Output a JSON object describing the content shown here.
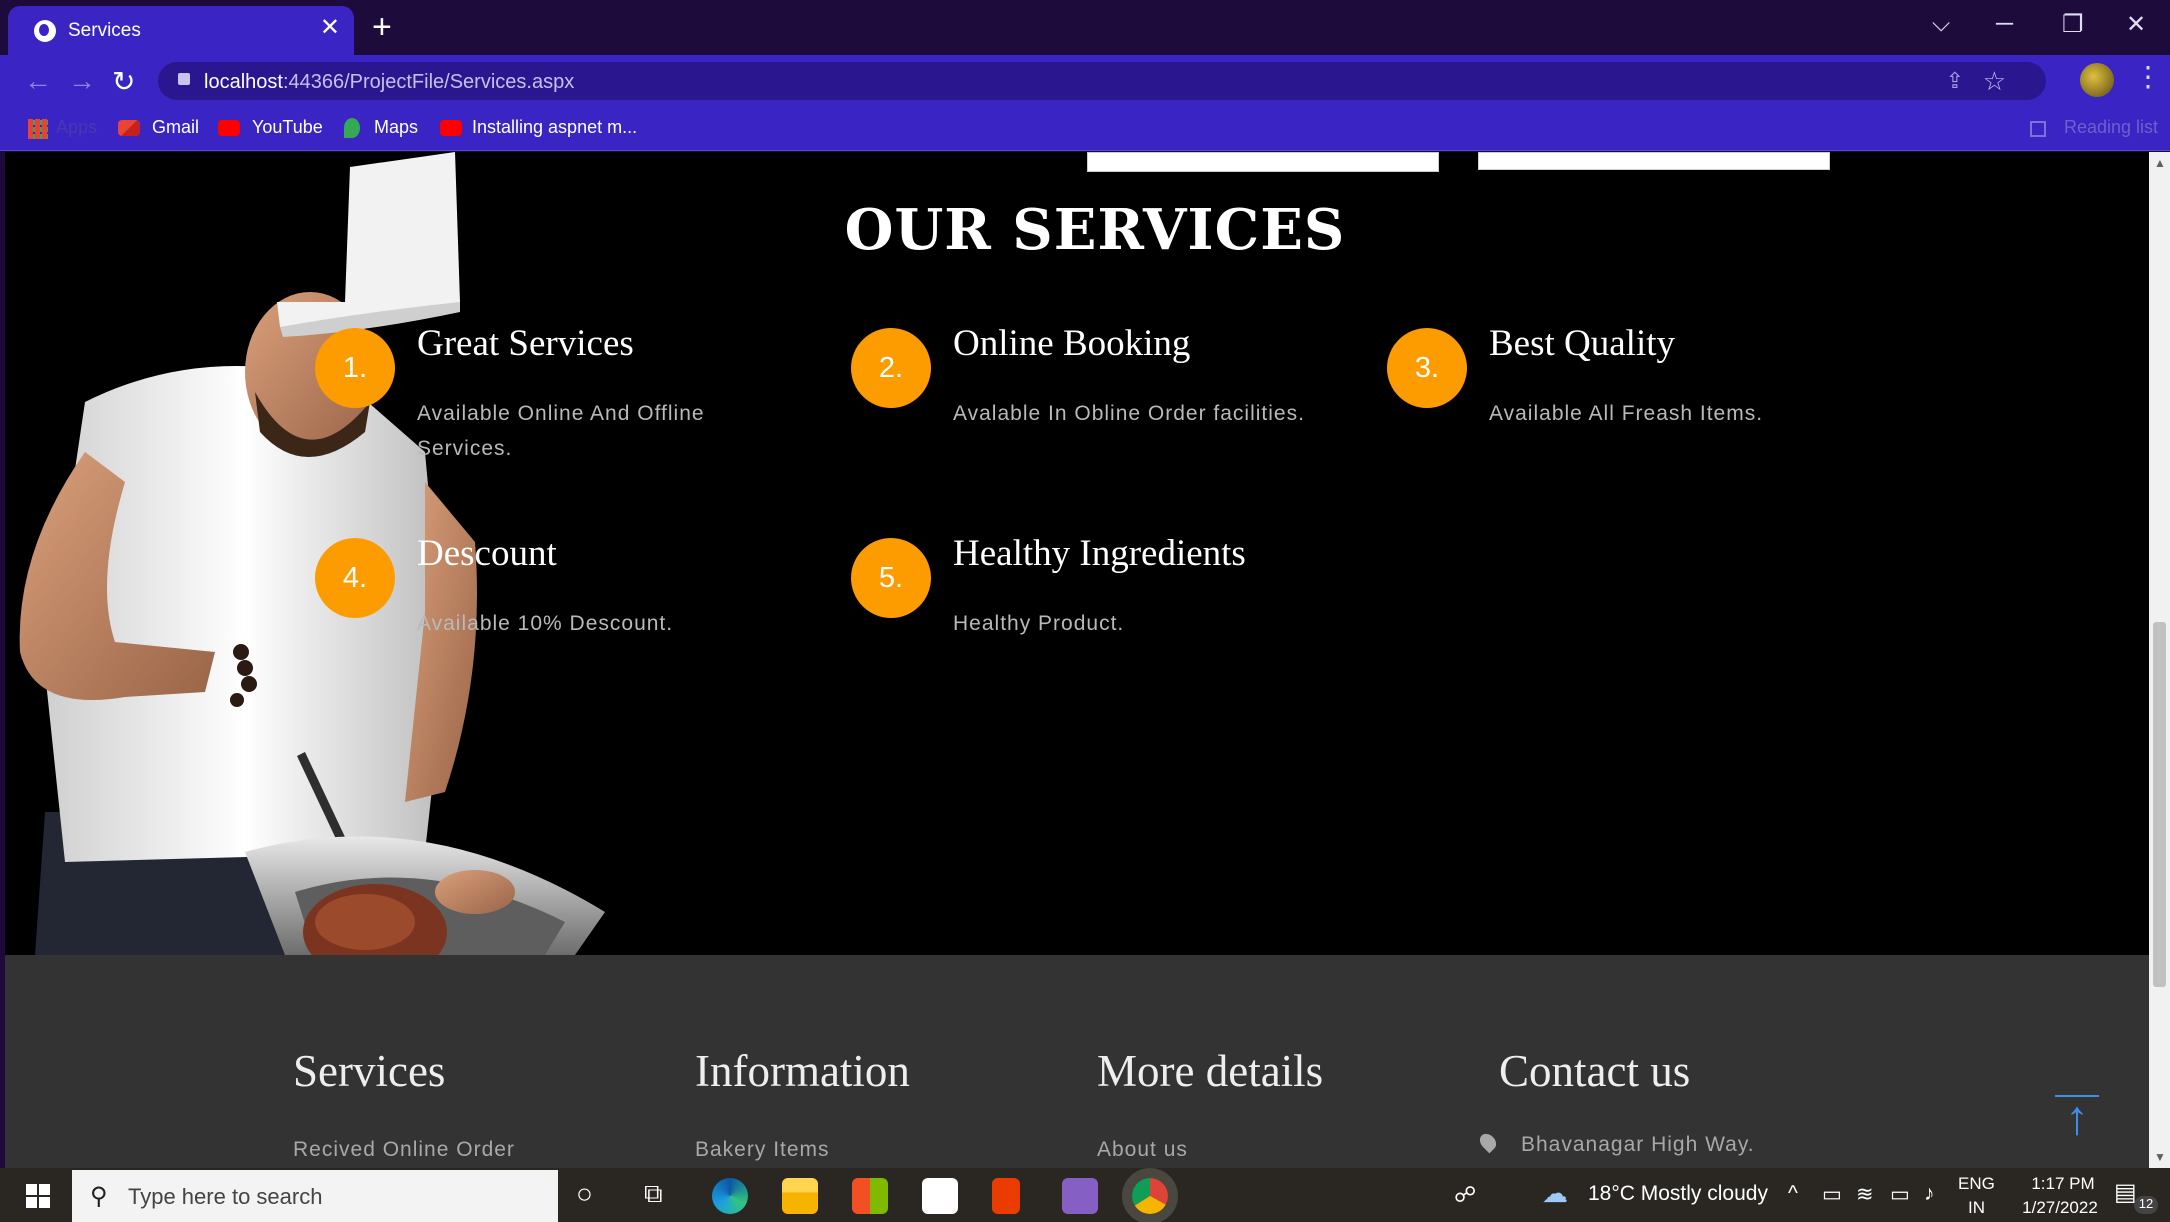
{
  "browser": {
    "tab_title": "Services",
    "tab_close": "✕",
    "new_tab": "+",
    "url_host": "localhost",
    "url_path": ":44366/ProjectFile/Services.aspx",
    "window_controls": [
      "⌵",
      "─",
      "❐",
      "✕"
    ],
    "bookmarks": [
      {
        "label": "Apps",
        "icon": "apps-icon"
      },
      {
        "label": "Gmail",
        "icon": "gmail-icon"
      },
      {
        "label": "YouTube",
        "icon": "youtube-icon"
      },
      {
        "label": "Maps",
        "icon": "maps-icon"
      },
      {
        "label": "Installing aspnet m...",
        "icon": "youtube-icon"
      }
    ],
    "reading_list": "Reading list"
  },
  "services_section": {
    "title": "OUR SERVICES",
    "items": [
      {
        "number": "1.",
        "name": "Great Services",
        "desc": "Available Online And Offline Services."
      },
      {
        "number": "2.",
        "name": "Online Booking",
        "desc": "Avalable In Obline Order facilities."
      },
      {
        "number": "3.",
        "name": "Best Quality",
        "desc": "Available All Freash Items."
      },
      {
        "number": "4.",
        "name": "Descount",
        "desc": "Available 10% Descount."
      },
      {
        "number": "5.",
        "name": "Healthy Ingredients",
        "desc": "Healthy Product."
      }
    ]
  },
  "footer": {
    "columns": [
      {
        "title": "Services",
        "first_link": "Recived Online Order"
      },
      {
        "title": "Information",
        "first_link": "Bakery Items"
      },
      {
        "title": "More details",
        "first_link": "About us"
      },
      {
        "title": "Contact us",
        "first_link": "Bhavanagar High Way."
      }
    ],
    "back_to_top": "↑"
  },
  "taskbar": {
    "search_placeholder": "Type here to search",
    "weather": "18°C  Mostly cloudy",
    "lang_top": "ENG",
    "lang_bottom": "IN",
    "time": "1:17 PM",
    "date": "1/27/2022",
    "notifications": "12"
  },
  "colors": {
    "accent_orange": "#fd9c00",
    "browser_chrome": "#3b24c4",
    "footer_bg": "#333333"
  }
}
